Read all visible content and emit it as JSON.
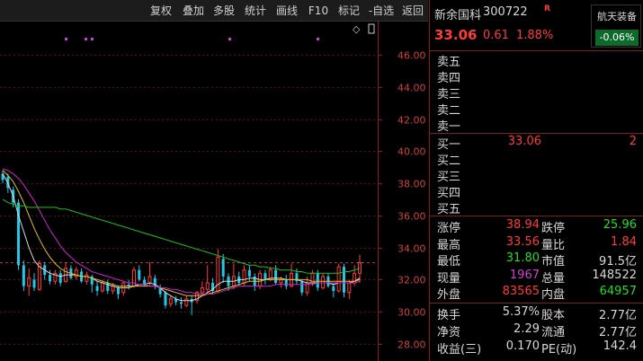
{
  "toolbar": {
    "buttons": [
      "复权",
      "叠加",
      "多股",
      "统计",
      "画线",
      "F10",
      "标记",
      "-自选",
      "返回"
    ]
  },
  "chart": {
    "y_ticks": [
      "46.00",
      "44.00",
      "42.00",
      "40.00",
      "38.00",
      "36.00",
      "34.00",
      "32.00",
      "30.00",
      "28.00"
    ],
    "icons": {
      "diamond": "◇",
      "window": "▯"
    }
  },
  "quote": {
    "name": "新余国科",
    "code": "300722",
    "badge": "R",
    "price": "33.06",
    "change": "0.61",
    "change_pct": "1.88%",
    "sector_name": "航天装备",
    "sector_pct": "-0.06%"
  },
  "asks": [
    {
      "label": "卖五",
      "price": "",
      "vol": ""
    },
    {
      "label": "卖四",
      "price": "",
      "vol": ""
    },
    {
      "label": "卖三",
      "price": "",
      "vol": ""
    },
    {
      "label": "卖二",
      "price": "",
      "vol": ""
    },
    {
      "label": "卖一",
      "price": "",
      "vol": ""
    }
  ],
  "bids": [
    {
      "label": "买一",
      "price": "33.06",
      "vol": "2"
    },
    {
      "label": "买二",
      "price": "",
      "vol": ""
    },
    {
      "label": "买三",
      "price": "",
      "vol": ""
    },
    {
      "label": "买四",
      "price": "",
      "vol": ""
    },
    {
      "label": "买五",
      "price": "",
      "vol": ""
    }
  ],
  "stats": [
    {
      "l1": "涨停",
      "v1": "38.94",
      "c1": "red",
      "l2": "跌停",
      "v2": "25.96",
      "c2": "green"
    },
    {
      "l1": "最高",
      "v1": "33.56",
      "c1": "red",
      "l2": "量比",
      "v2": "1.84",
      "c2": "red"
    },
    {
      "l1": "最低",
      "v1": "31.80",
      "c1": "green",
      "l2": "市值",
      "v2": "91.5亿",
      "c2": "white"
    },
    {
      "l1": "现量",
      "v1": "1967",
      "c1": "purple",
      "l2": "总量",
      "v2": "148522",
      "c2": "white"
    },
    {
      "l1": "外盘",
      "v1": "83565",
      "c1": "red",
      "l2": "内盘",
      "v2": "64957",
      "c2": "green"
    }
  ],
  "stats2": [
    {
      "l1": "换手",
      "v1": "5.37%",
      "l2": "股本",
      "v2": "2.77亿"
    },
    {
      "l1": "净资",
      "v1": "2.29",
      "l2": "流通",
      "v2": "2.77亿"
    },
    {
      "l1": "收益(三)",
      "v1": "0.170",
      "l2": "PE(动)",
      "v2": "142.4"
    }
  ],
  "chart_data": {
    "type": "candlestick",
    "ylim": [
      27,
      48
    ],
    "reference_price": 33.06,
    "candles": [
      {
        "o": 38.6,
        "c": 38.2,
        "h": 38.8,
        "l": 38.0
      },
      {
        "o": 38.4,
        "c": 37.7,
        "h": 38.6,
        "l": 37.4
      },
      {
        "o": 37.6,
        "c": 36.8,
        "h": 37.8,
        "l": 36.5
      },
      {
        "o": 36.8,
        "c": 32.9,
        "h": 37.0,
        "l": 32.6
      },
      {
        "o": 32.9,
        "c": 31.6,
        "h": 33.2,
        "l": 31.3
      },
      {
        "o": 31.6,
        "c": 32.1,
        "h": 32.7,
        "l": 31.0
      },
      {
        "o": 32.0,
        "c": 31.5,
        "h": 32.4,
        "l": 31.3
      },
      {
        "o": 31.4,
        "c": 33.0,
        "h": 33.2,
        "l": 31.3
      },
      {
        "o": 32.9,
        "c": 32.3,
        "h": 33.1,
        "l": 32.0
      },
      {
        "o": 32.3,
        "c": 31.9,
        "h": 32.6,
        "l": 31.7
      },
      {
        "o": 31.9,
        "c": 32.4,
        "h": 32.6,
        "l": 31.7
      },
      {
        "o": 32.4,
        "c": 31.8,
        "h": 32.6,
        "l": 31.6
      },
      {
        "o": 31.9,
        "c": 32.7,
        "h": 33.1,
        "l": 31.8
      },
      {
        "o": 32.7,
        "c": 32.1,
        "h": 32.9,
        "l": 32.0
      },
      {
        "o": 32.2,
        "c": 32.6,
        "h": 32.8,
        "l": 32.0
      },
      {
        "o": 32.5,
        "c": 31.9,
        "h": 32.7,
        "l": 31.8
      },
      {
        "o": 31.9,
        "c": 32.3,
        "h": 32.5,
        "l": 31.7
      },
      {
        "o": 32.2,
        "c": 31.7,
        "h": 32.3,
        "l": 31.2
      },
      {
        "o": 31.6,
        "c": 31.3,
        "h": 31.9,
        "l": 31.0
      },
      {
        "o": 31.3,
        "c": 31.8,
        "h": 32.0,
        "l": 31.2
      },
      {
        "o": 31.8,
        "c": 31.3,
        "h": 32.0,
        "l": 31.1
      },
      {
        "o": 31.3,
        "c": 31.6,
        "h": 31.8,
        "l": 31.1
      },
      {
        "o": 31.5,
        "c": 31.1,
        "h": 31.6,
        "l": 30.8
      },
      {
        "o": 31.2,
        "c": 31.8,
        "h": 31.9,
        "l": 31.0
      },
      {
        "o": 31.7,
        "c": 31.6,
        "h": 32.0,
        "l": 31.4
      },
      {
        "o": 31.6,
        "c": 32.6,
        "h": 32.8,
        "l": 31.5
      },
      {
        "o": 32.6,
        "c": 32.0,
        "h": 32.9,
        "l": 31.9
      },
      {
        "o": 32.0,
        "c": 31.7,
        "h": 32.2,
        "l": 31.6
      },
      {
        "o": 31.8,
        "c": 32.2,
        "h": 33.1,
        "l": 31.6
      },
      {
        "o": 32.1,
        "c": 31.6,
        "h": 32.3,
        "l": 31.4
      },
      {
        "o": 31.5,
        "c": 31.1,
        "h": 31.7,
        "l": 30.9
      },
      {
        "o": 31.2,
        "c": 30.4,
        "h": 31.3,
        "l": 30.2
      },
      {
        "o": 30.5,
        "c": 30.8,
        "h": 31.0,
        "l": 30.3
      },
      {
        "o": 30.8,
        "c": 30.6,
        "h": 31.0,
        "l": 30.4
      },
      {
        "o": 30.6,
        "c": 30.5,
        "h": 30.9,
        "l": 30.2
      },
      {
        "o": 30.4,
        "c": 30.8,
        "h": 31.0,
        "l": 30.3
      },
      {
        "o": 30.8,
        "c": 30.6,
        "h": 31.0,
        "l": 29.8
      },
      {
        "o": 30.7,
        "c": 31.2,
        "h": 31.3,
        "l": 30.5
      },
      {
        "o": 31.2,
        "c": 31.5,
        "h": 31.9,
        "l": 31.0
      },
      {
        "o": 31.4,
        "c": 31.8,
        "h": 32.9,
        "l": 31.2
      },
      {
        "o": 31.8,
        "c": 31.3,
        "h": 32.1,
        "l": 31.1
      },
      {
        "o": 31.3,
        "c": 33.4,
        "h": 33.9,
        "l": 31.2
      },
      {
        "o": 33.3,
        "c": 32.2,
        "h": 33.6,
        "l": 31.8
      },
      {
        "o": 32.2,
        "c": 31.6,
        "h": 32.4,
        "l": 31.3
      },
      {
        "o": 31.6,
        "c": 32.2,
        "h": 33.0,
        "l": 31.4
      },
      {
        "o": 32.2,
        "c": 31.8,
        "h": 32.5,
        "l": 31.6
      },
      {
        "o": 31.8,
        "c": 32.6,
        "h": 32.9,
        "l": 31.6
      },
      {
        "o": 32.6,
        "c": 32.2,
        "h": 32.9,
        "l": 31.9
      },
      {
        "o": 32.2,
        "c": 31.6,
        "h": 32.4,
        "l": 31.3
      },
      {
        "o": 31.6,
        "c": 32.4,
        "h": 32.6,
        "l": 31.4
      },
      {
        "o": 32.4,
        "c": 32.0,
        "h": 32.6,
        "l": 31.7
      },
      {
        "o": 32.0,
        "c": 32.6,
        "h": 32.8,
        "l": 31.9
      },
      {
        "o": 32.6,
        "c": 31.8,
        "h": 32.9,
        "l": 31.7
      },
      {
        "o": 31.8,
        "c": 32.0,
        "h": 32.2,
        "l": 31.5
      },
      {
        "o": 32.0,
        "c": 31.6,
        "h": 32.3,
        "l": 31.4
      },
      {
        "o": 31.6,
        "c": 32.4,
        "h": 33.0,
        "l": 31.5
      },
      {
        "o": 32.4,
        "c": 31.9,
        "h": 32.7,
        "l": 31.7
      },
      {
        "o": 31.9,
        "c": 31.2,
        "h": 32.0,
        "l": 31.0
      },
      {
        "o": 31.2,
        "c": 31.8,
        "h": 32.2,
        "l": 31.0
      },
      {
        "o": 31.8,
        "c": 32.4,
        "h": 32.6,
        "l": 31.6
      },
      {
        "o": 32.4,
        "c": 31.5,
        "h": 32.6,
        "l": 31.3
      },
      {
        "o": 31.5,
        "c": 32.2,
        "h": 32.4,
        "l": 31.4
      },
      {
        "o": 32.2,
        "c": 31.6,
        "h": 32.4,
        "l": 31.5
      },
      {
        "o": 31.6,
        "c": 31.3,
        "h": 31.8,
        "l": 30.9
      },
      {
        "o": 31.3,
        "c": 32.8,
        "h": 33.0,
        "l": 31.2
      },
      {
        "o": 32.8,
        "c": 31.2,
        "h": 33.0,
        "l": 30.9
      },
      {
        "o": 31.2,
        "c": 31.8,
        "h": 32.0,
        "l": 30.8
      },
      {
        "o": 31.8,
        "c": 32.4,
        "h": 32.9,
        "l": 31.6
      },
      {
        "o": 32.4,
        "c": 33.06,
        "h": 33.56,
        "l": 31.8
      }
    ],
    "ma_series": [
      {
        "color": "#d8d8d8",
        "values": [
          38.6,
          38.0,
          37.2,
          36.0,
          35.0,
          34.0,
          33.2,
          32.8,
          32.6,
          32.4,
          32.3,
          32.2,
          32.3,
          32.3,
          32.3,
          32.2,
          32.2,
          32.1,
          31.9,
          31.8,
          31.7,
          31.6,
          31.5,
          31.5,
          31.5,
          31.6,
          31.7,
          31.7,
          31.8,
          31.7,
          31.5,
          31.2,
          31.0,
          30.8,
          30.7,
          30.7,
          30.7,
          30.8,
          31.0,
          31.2,
          31.4,
          31.7,
          31.9,
          31.9,
          31.9,
          32.0,
          32.0,
          32.1,
          32.1,
          32.0,
          32.0,
          32.1,
          32.1,
          32.1,
          32.0,
          32.0,
          32.0,
          31.9,
          31.8,
          31.8,
          31.8,
          31.8,
          31.8,
          31.7,
          31.8,
          31.8,
          31.8,
          31.9,
          32.1
        ]
      },
      {
        "color": "#e0c020",
        "values": [
          38.8,
          38.5,
          38.1,
          37.5,
          36.8,
          36.0,
          35.2,
          34.5,
          33.9,
          33.4,
          33.0,
          32.7,
          32.5,
          32.4,
          32.3,
          32.2,
          32.2,
          32.1,
          32.0,
          31.9,
          31.8,
          31.7,
          31.6,
          31.6,
          31.6,
          31.6,
          31.6,
          31.6,
          31.6,
          31.6,
          31.5,
          31.4,
          31.3,
          31.2,
          31.1,
          31.0,
          31.0,
          31.0,
          31.0,
          31.1,
          31.2,
          31.3,
          31.4,
          31.5,
          31.6,
          31.7,
          31.8,
          31.9,
          31.9,
          31.9,
          32.0,
          32.0,
          32.0,
          32.0,
          32.0,
          32.0,
          32.0,
          32.0,
          32.0,
          31.9,
          31.9,
          31.9,
          31.9,
          31.9,
          31.9,
          31.9,
          31.9,
          31.9,
          32.0
        ]
      },
      {
        "color": "#d020d0",
        "values": [
          38.9,
          38.8,
          38.6,
          38.3,
          37.9,
          37.4,
          36.9,
          36.3,
          35.7,
          35.1,
          34.6,
          34.1,
          33.7,
          33.4,
          33.1,
          32.9,
          32.7,
          32.5,
          32.4,
          32.3,
          32.2,
          32.1,
          32.0,
          31.9,
          31.8,
          31.8,
          31.7,
          31.7,
          31.6,
          31.6,
          31.5,
          31.5,
          31.4,
          31.4,
          31.3,
          31.2,
          31.2,
          31.1,
          31.1,
          31.1,
          31.1,
          31.2,
          31.3,
          31.4,
          31.5,
          31.6,
          31.6,
          31.6,
          31.6,
          31.6,
          31.6,
          31.6,
          31.7,
          31.7,
          31.7,
          31.7,
          31.7,
          31.7,
          31.7,
          31.7,
          31.8,
          31.8,
          31.8,
          31.8,
          31.8,
          31.8,
          31.8,
          31.8,
          31.9
        ]
      },
      {
        "color": "#20c020",
        "values": [
          37.0,
          36.8,
          36.7,
          36.6,
          36.6,
          36.5,
          36.5,
          36.5,
          36.5,
          36.5,
          36.5,
          36.4,
          36.4,
          36.3,
          36.2,
          36.1,
          36.0,
          35.9,
          35.8,
          35.7,
          35.6,
          35.5,
          35.4,
          35.3,
          35.2,
          35.1,
          35.0,
          34.9,
          34.8,
          34.7,
          34.6,
          34.5,
          34.4,
          34.3,
          34.2,
          34.1,
          34.0,
          33.9,
          33.8,
          33.7,
          33.6,
          33.5,
          33.4,
          33.3,
          33.2,
          33.1,
          33.0,
          32.9,
          32.9,
          32.8,
          32.8,
          32.7,
          32.7,
          32.6,
          32.6,
          32.6,
          32.5,
          32.5,
          32.4,
          32.4,
          32.4,
          32.4,
          32.4,
          32.4,
          32.4,
          32.5,
          32.5,
          32.6,
          32.7
        ]
      }
    ],
    "volume_unit": "",
    "grid": true
  }
}
